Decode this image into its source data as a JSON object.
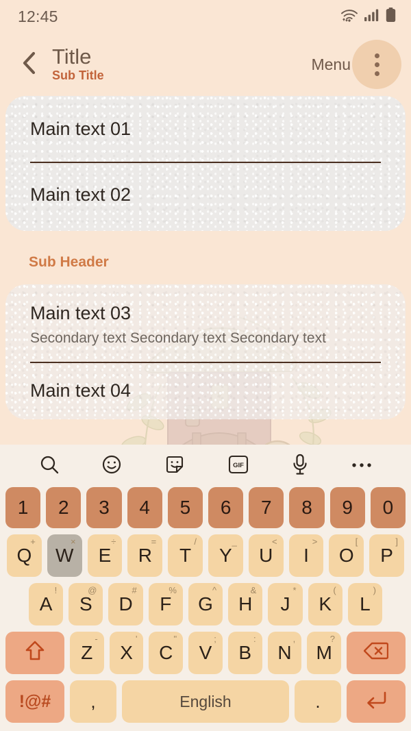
{
  "statusbar": {
    "time": "12:45",
    "wifi_icon": "wifi-icon",
    "signal_icon": "signal-icon",
    "battery_icon": "battery-icon"
  },
  "appbar": {
    "back_icon": "back-chevron-icon",
    "title": "Title",
    "subtitle": "Sub Title",
    "menu_label": "Menu",
    "overflow_icon": "more-vertical-icon"
  },
  "content": {
    "card1": {
      "rows": [
        {
          "main": "Main text 01"
        },
        {
          "main": "Main text 02"
        }
      ]
    },
    "sub_header": "Sub Header",
    "card2": {
      "rows": [
        {
          "main": "Main text 03",
          "secondary": "Secondary text Secondary text Secondary text"
        },
        {
          "main": "Main text 04"
        }
      ]
    }
  },
  "keyboard": {
    "toolbar": [
      {
        "name": "search-icon",
        "label": "Search"
      },
      {
        "name": "emoji-icon",
        "label": "Emoji"
      },
      {
        "name": "sticker-icon",
        "label": "Sticker"
      },
      {
        "name": "gif-icon",
        "label": "GIF"
      },
      {
        "name": "microphone-icon",
        "label": "Voice input"
      },
      {
        "name": "more-horizontal-icon",
        "label": "More"
      }
    ],
    "row_numbers": [
      "1",
      "2",
      "3",
      "4",
      "5",
      "6",
      "7",
      "8",
      "9",
      "0"
    ],
    "row_q": [
      {
        "key": "Q",
        "sup": "+"
      },
      {
        "key": "W",
        "sup": "×",
        "pressed": true
      },
      {
        "key": "E",
        "sup": "÷"
      },
      {
        "key": "R",
        "sup": "="
      },
      {
        "key": "T",
        "sup": "/"
      },
      {
        "key": "Y",
        "sup": "_"
      },
      {
        "key": "U",
        "sup": "<"
      },
      {
        "key": "I",
        "sup": ">"
      },
      {
        "key": "O",
        "sup": "["
      },
      {
        "key": "P",
        "sup": "]"
      }
    ],
    "row_a": [
      {
        "key": "A",
        "sup": "!"
      },
      {
        "key": "S",
        "sup": "@"
      },
      {
        "key": "D",
        "sup": "#"
      },
      {
        "key": "F",
        "sup": "%"
      },
      {
        "key": "G",
        "sup": "^"
      },
      {
        "key": "H",
        "sup": "&"
      },
      {
        "key": "J",
        "sup": "*"
      },
      {
        "key": "K",
        "sup": "("
      },
      {
        "key": "L",
        "sup": ")"
      }
    ],
    "row_z": [
      {
        "key": "Z",
        "sup": "-"
      },
      {
        "key": "X",
        "sup": "'"
      },
      {
        "key": "C",
        "sup": "\""
      },
      {
        "key": "V",
        "sup": ";"
      },
      {
        "key": "B",
        "sup": ":"
      },
      {
        "key": "N",
        "sup": ","
      },
      {
        "key": "M",
        "sup": "?"
      }
    ],
    "shift_icon": "shift-arrow-icon",
    "backspace_icon": "backspace-icon",
    "symbols_label": "!@#",
    "comma_label": ",",
    "space_label": "English",
    "period_label": ".",
    "enter_icon": "enter-return-icon"
  },
  "colors": {
    "page_bg": "#fae6d4",
    "card_bg": "#eceae8",
    "accent_orange": "#c2633a",
    "subheader": "#d07a46",
    "key_letter": "#f5d5a4",
    "key_number": "#cf8a62",
    "key_function": "#eda884",
    "key_pressed": "#b8b1a6",
    "keyboard_bg": "#f6efe7",
    "menu_circle": "#f0cfae"
  }
}
